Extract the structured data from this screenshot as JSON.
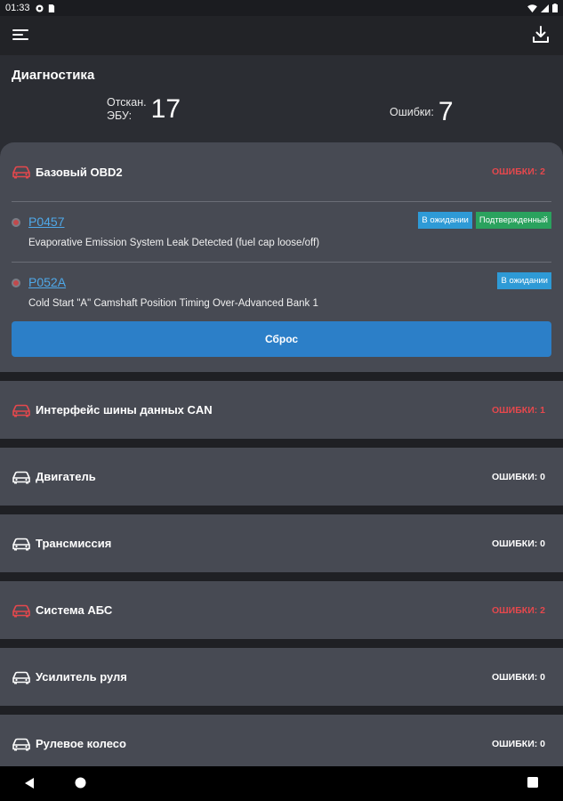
{
  "status": {
    "time": "01:33"
  },
  "header": {
    "title": "Диагностика",
    "scanned_label_line1": "Отскан.",
    "scanned_label_line2": "ЭБУ:",
    "scanned_value": "17",
    "errors_label": "Ошибки:",
    "errors_value": "7"
  },
  "colors": {
    "error_red": "#e5484d",
    "accent_blue": "#2c7fc8",
    "link_blue": "#4fa8e8",
    "badge_blue": "#2e9ad6",
    "badge_green": "#2aa25e"
  },
  "modules": [
    {
      "name": "Базовый OBD2",
      "errors": "ОШИБКИ: 2",
      "has_errors": true,
      "expanded": true,
      "codes": [
        {
          "code": "P0457",
          "description": "Evaporative Emission System Leak Detected (fuel cap loose/off)",
          "badges": [
            "В ожидании",
            "Подтвержденный"
          ]
        },
        {
          "code": "P052A",
          "description": "Cold Start \"A\" Camshaft Position Timing Over-Advanced Bank 1",
          "badges": [
            "В ожидании"
          ]
        }
      ],
      "reset_label": "Сброс"
    },
    {
      "name": "Интерфейс шины данных CAN",
      "errors": "ОШИБКИ: 1",
      "has_errors": true
    },
    {
      "name": "Двигатель",
      "errors": "ОШИБКИ: 0",
      "has_errors": false
    },
    {
      "name": "Трансмиссия",
      "errors": "ОШИБКИ: 0",
      "has_errors": false
    },
    {
      "name": "Система АБС",
      "errors": "ОШИБКИ: 2",
      "has_errors": true
    },
    {
      "name": "Усилитель руля",
      "errors": "ОШИБКИ: 0",
      "has_errors": false
    },
    {
      "name": "Рулевое колесо",
      "errors": "ОШИБКИ: 0",
      "has_errors": false
    }
  ]
}
